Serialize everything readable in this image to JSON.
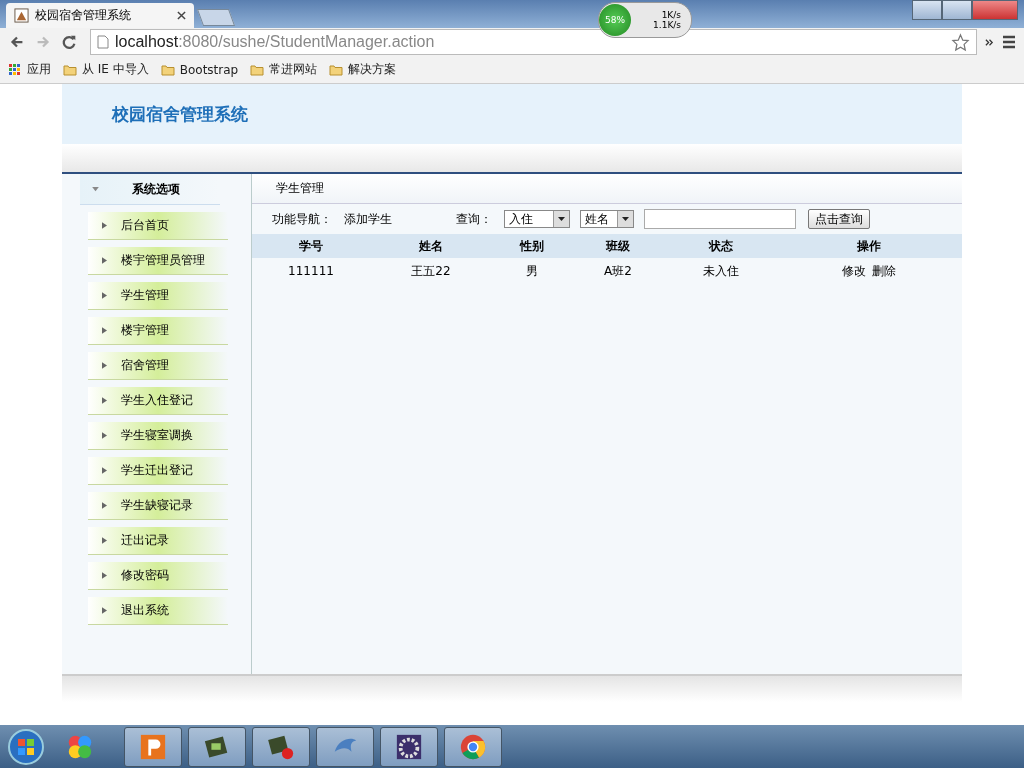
{
  "browser": {
    "tab_title": "校园宿舍管理系统",
    "url_host": "localhost",
    "url_rest": ":8080/sushe/StudentManager.action",
    "bookmarks": [
      {
        "label": "应用",
        "kind": "apps"
      },
      {
        "label": "从 IE 中导入",
        "kind": "folder"
      },
      {
        "label": "Bootstrap",
        "kind": "folder"
      },
      {
        "label": "常进网站",
        "kind": "folder"
      },
      {
        "label": "解决方案",
        "kind": "folder"
      }
    ]
  },
  "net_meter": {
    "percent": "58%",
    "up": "1K/s",
    "down": "1.1K/s"
  },
  "site": {
    "title": "校园宿舍管理系统"
  },
  "sidebar": {
    "heading": "系统选项",
    "items": [
      {
        "label": "后台首页"
      },
      {
        "label": "楼宇管理员管理"
      },
      {
        "label": "学生管理"
      },
      {
        "label": "楼宇管理"
      },
      {
        "label": "宿舍管理"
      },
      {
        "label": "学生入住登记"
      },
      {
        "label": "学生寝室调换"
      },
      {
        "label": "学生迁出登记"
      },
      {
        "label": "学生缺寝记录"
      },
      {
        "label": "迁出记录"
      },
      {
        "label": "修改密码"
      },
      {
        "label": "退出系统"
      }
    ]
  },
  "main": {
    "title": "学生管理",
    "nav_label": "功能导航：",
    "nav_link": "添加学生",
    "query_label": "查询：",
    "status_select": "入住",
    "field_select": "姓名",
    "search_button": "点击查询",
    "columns": [
      "学号",
      "姓名",
      "性别",
      "班级",
      "状态",
      "操作"
    ],
    "rows": [
      {
        "cells": [
          "111111",
          "王五22",
          "男",
          "A班2",
          "未入住"
        ],
        "actions": [
          "修改",
          "删除"
        ]
      }
    ]
  },
  "taskbar": {
    "apps": [
      {
        "kind": "start"
      },
      {
        "kind": "pinwheel"
      },
      {
        "kind": "presenter"
      },
      {
        "kind": "console"
      },
      {
        "kind": "record"
      },
      {
        "kind": "dolphin"
      },
      {
        "kind": "gear"
      },
      {
        "kind": "chrome"
      }
    ]
  }
}
